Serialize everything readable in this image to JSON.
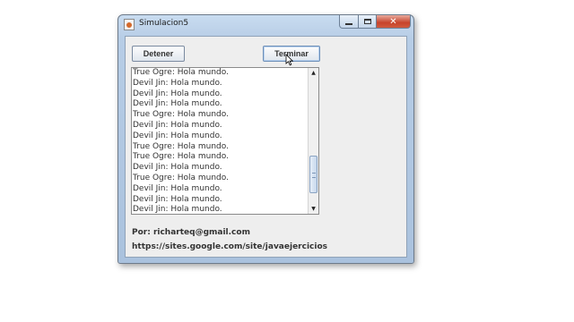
{
  "window": {
    "title": "Simulacion5",
    "controls": {
      "minimize": "minimize",
      "maximize": "maximize",
      "close": "✕"
    }
  },
  "toolbar": {
    "stop_label": "Detener",
    "finish_label": "Terminar"
  },
  "log": {
    "lines": [
      "True Ogre: Hola mundo.",
      "Devil Jin: Hola mundo.",
      "Devil Jin: Hola mundo.",
      "Devil Jin: Hola mundo.",
      "True Ogre: Hola mundo.",
      "Devil Jin: Hola mundo.",
      "Devil Jin: Hola mundo.",
      "True Ogre: Hola mundo.",
      "True Ogre: Hola mundo.",
      "Devil Jin: Hola mundo.",
      "True Ogre: Hola mundo.",
      "Devil Jin: Hola mundo.",
      "Devil Jin: Hola mundo.",
      "Devil Jin: Hola mundo."
    ],
    "scroll_up_icon": "▲",
    "scroll_down_icon": "▼"
  },
  "footer": {
    "author": "Por: richarteq@gmail.com",
    "site": "https://sites.google.com/site/javaejercicios"
  },
  "colors": {
    "title_bar": "#b7cde6",
    "close_button": "#c7432b",
    "panel_background": "#eeeeee"
  }
}
